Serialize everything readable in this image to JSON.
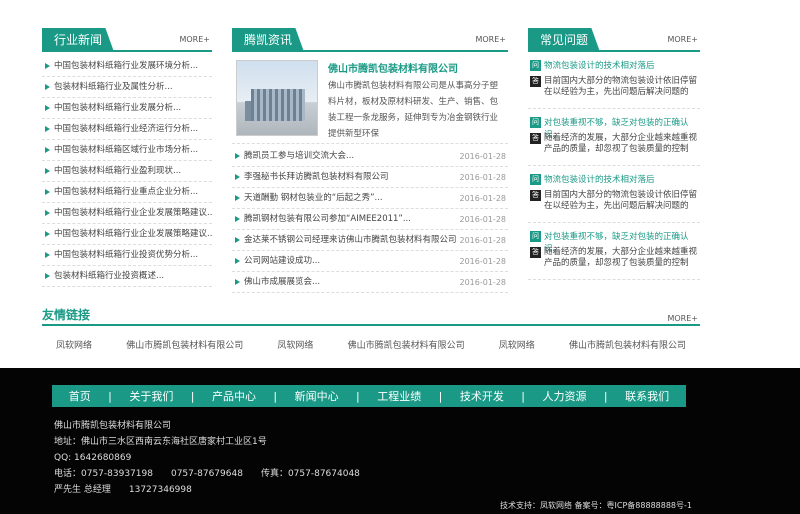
{
  "more_label": "MORE+",
  "industry": {
    "title": "行业新闻",
    "items": [
      "中国包装材料纸箱行业发展环境分析...",
      "包装材料纸箱行业及属性分析...",
      "中国包装材料纸箱行业发展分析...",
      "中国包装材料纸箱行业经济运行分析...",
      "中国包装材料纸箱区域行业市场分析...",
      "中国包装材料纸箱行业盈利现状...",
      "中国包装材料纸箱行业重点企业分析...",
      "中国包装材料纸箱行业企业发展策略建议...",
      "中国包装材料纸箱行业企业发展策略建议...",
      "中国包装材料纸箱行业投资优势分析...",
      "包装材料纸箱行业投资概述..."
    ]
  },
  "company": {
    "title": "腾凯资讯",
    "featured_title": "佛山市腾凯包装材料有限公司",
    "featured_text": "佛山市腾凯包装材料有限公司是从事高分子塑料片材，板材及原材料研发、生产、销售、包装工程一条龙服务，延伸到专为冶金钢铁行业提供新型环保",
    "items": [
      {
        "text": "腾凯员工参与培训交流大会...",
        "date": "2016-01-28"
      },
      {
        "text": "李强秘书长拜访腾凯包装材料有限公司",
        "date": "2016-01-28"
      },
      {
        "text": "天道酬勤 钢材包装业的“后起之秀”...",
        "date": "2016-01-28"
      },
      {
        "text": "腾凯钢材包装有限公司参加“AIMEE2011”...",
        "date": "2016-01-28"
      },
      {
        "text": "金达莱不锈钢公司经理来访佛山市腾凯包装材料有限公司",
        "date": "2016-01-28"
      },
      {
        "text": "公司网站建设成功...",
        "date": "2016-01-28"
      },
      {
        "text": "佛山市成展展览会...",
        "date": "2016-01-28"
      }
    ]
  },
  "faq": {
    "title": "常见问题",
    "items": [
      {
        "q": "物流包装设计的技术相对落后",
        "a": "目前国内大部分的物流包装设计依旧停留在以经验为主，先出问题后解决问题的"
      },
      {
        "q": "对包装重视不够，缺乏对包装的正确认识。",
        "a": "随着经济的发展，大部分企业越来越重视产品的质量，却忽视了包装质量的控制"
      },
      {
        "q": "物流包装设计的技术相对落后",
        "a": "目前国内大部分的物流包装设计依旧停留在以经验为主，先出问题后解决问题的"
      },
      {
        "q": "对包装重视不够，缺乏对包装的正确认识。",
        "a": "随着经济的发展，大部分企业越来越重视产品的质量，却忽视了包装质量的控制"
      }
    ]
  },
  "links": {
    "title": "友情链接",
    "items": [
      "凤软网络",
      "佛山市腾凯包装材料有限公司",
      "凤软网络",
      "佛山市腾凯包装材料有限公司",
      "凤软网络",
      "佛山市腾凯包装材料有限公司"
    ]
  },
  "nav": [
    "首页",
    "关于我们",
    "产品中心",
    "新闻中心",
    "工程业绩",
    "技术开发",
    "人力资源",
    "联系我们"
  ],
  "nav_sep": "|",
  "footer": {
    "company": "佛山市腾凯包装材料有限公司",
    "address": "地址：佛山市三水区西南云东海社区唐家村工业区1号",
    "qq": "QQ: 1642680869",
    "phone": "电话：0757-83937198",
    "phone2": "0757-87679648",
    "fax": "传真：0757-87674048",
    "contact": "严先生 总经理",
    "mobile": "13727346998",
    "bottom": "技术支持：凤软网络   备案号：粤ICP备88888888号-1"
  },
  "colors": {
    "accent": "#1a9a86",
    "footer_bg": "#040404"
  }
}
